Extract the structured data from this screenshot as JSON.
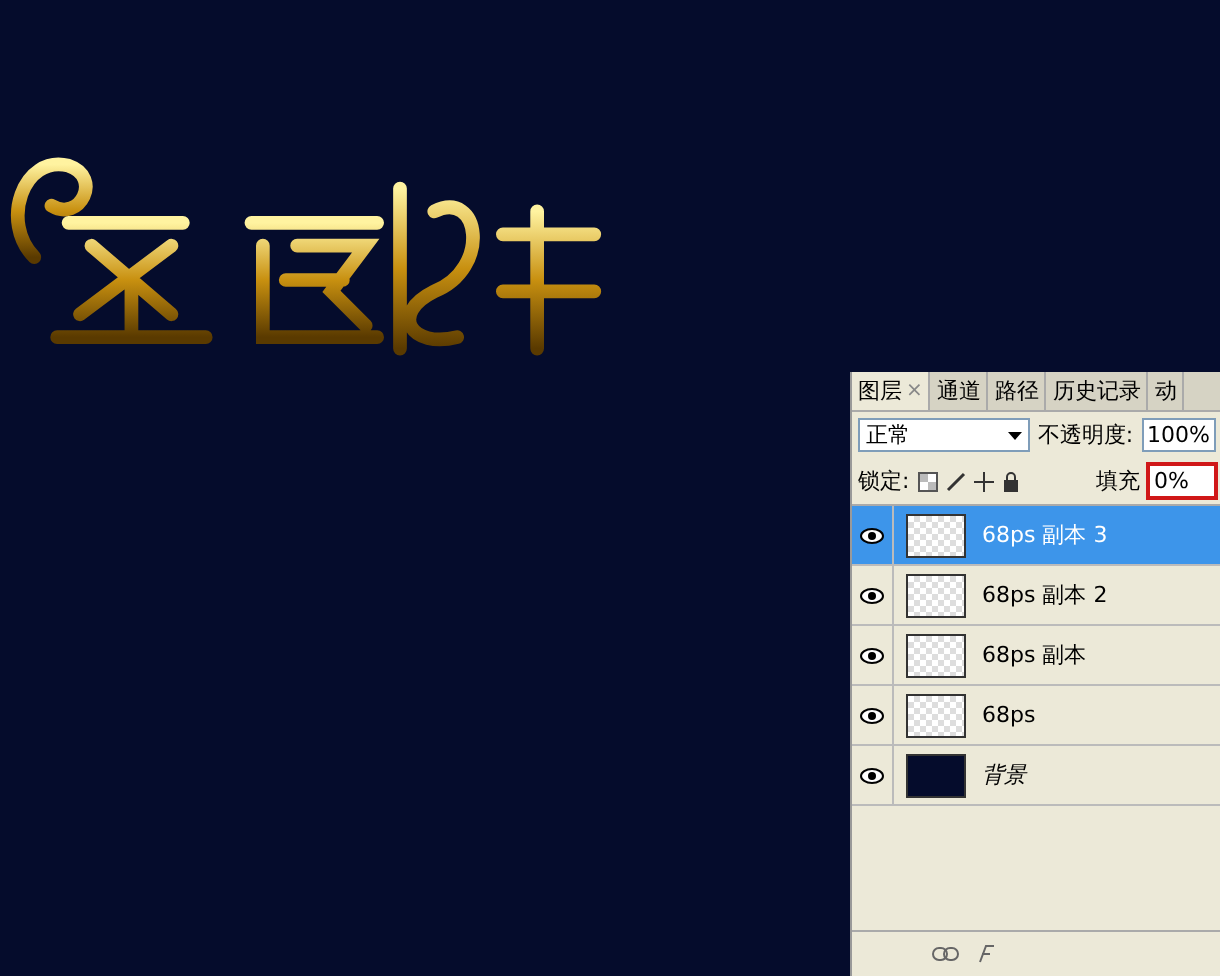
{
  "layers_panel": {
    "tabs": [
      {
        "label": "图层",
        "close": "×",
        "selected": true
      },
      {
        "label": "通道",
        "selected": false
      },
      {
        "label": "路径",
        "selected": false
      },
      {
        "label": "历史记录",
        "selected": false
      },
      {
        "label": "动",
        "selected": false
      }
    ],
    "blend_mode": {
      "value": "正常"
    },
    "opacity": {
      "label": "不透明度:",
      "value": "100%"
    },
    "lock": {
      "label": "锁定:"
    },
    "fill": {
      "label": "填充",
      "value": "0%",
      "highlighted": true
    },
    "layers": [
      {
        "name": "68ps 副本 3",
        "kind": "transparent",
        "visible": true,
        "selected": true
      },
      {
        "name": "68ps 副本 2",
        "kind": "transparent",
        "visible": true,
        "selected": false
      },
      {
        "name": "68ps 副本",
        "kind": "transparent",
        "visible": true,
        "selected": false
      },
      {
        "name": "68ps",
        "kind": "transparent",
        "visible": true,
        "selected": false
      },
      {
        "name": "背景",
        "kind": "solid",
        "visible": true,
        "selected": false
      }
    ]
  }
}
